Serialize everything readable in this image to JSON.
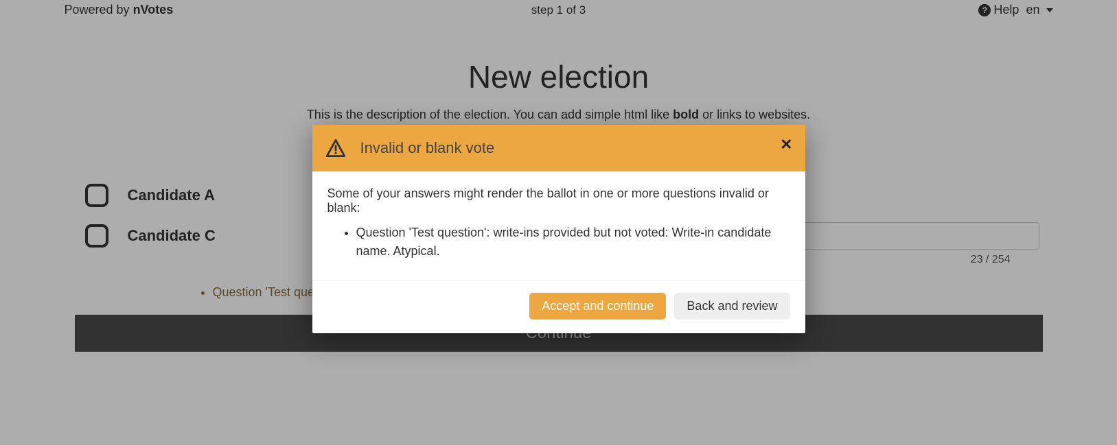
{
  "topbar": {
    "powered_prefix": "Powered by ",
    "powered_brand": "nVotes",
    "step": "step 1 of 3",
    "help_label": "Help",
    "language": "en"
  },
  "header": {
    "title": "New election",
    "description_prefix": "This is the description of the election. You can add simple html like ",
    "description_bold": "bold",
    "description_suffix": " or links to websites."
  },
  "candidates": [
    {
      "label": "Candidate A"
    },
    {
      "label": "Candidate C"
    }
  ],
  "writein": {
    "char_counter": "23 / 254"
  },
  "page_warning": {
    "items": [
      "Question 'Test question': write-ins provided but not voted: Write-in candidate name. Atypical."
    ]
  },
  "continue_button": "Continue",
  "modal": {
    "title": "Invalid or blank vote",
    "intro": "Some of your answers might render the ballot in one or more questions invalid or blank:",
    "items": [
      "Question 'Test question': write-ins provided but not voted: Write-in candidate name. Atypical."
    ],
    "accept_label": "Accept and continue",
    "back_label": "Back and review"
  }
}
